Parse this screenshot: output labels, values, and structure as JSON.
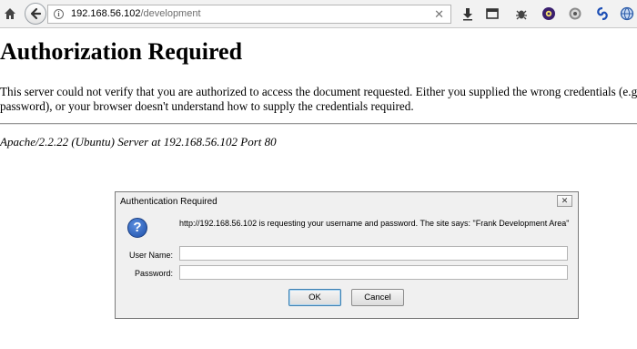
{
  "browser": {
    "url_host": "192.168.56.102",
    "url_path": "/development",
    "colors": {
      "toolbar_bg": "#f2f2f2"
    },
    "icons": [
      "home-icon",
      "back-arrow-icon",
      "page-info-icon",
      "clear-url-icon",
      "download-icon",
      "reader-view-icon",
      "addon-bug-icon",
      "addon-gear-icon",
      "addon-cog-icon",
      "addon-swirl-icon",
      "addon-globe-icon"
    ]
  },
  "page": {
    "title": "Authorization Required",
    "message": "This server could not verify that you are authorized to access the document requested. Either you supplied the wrong credentials (e.g., bad password), or your browser doesn't understand how to supply the credentials required.",
    "signature": "Apache/2.2.22 (Ubuntu) Server at 192.168.56.102 Port 80"
  },
  "dialog": {
    "title": "Authentication Required",
    "close_label": "✕",
    "message": "http://192.168.56.102 is requesting your username and password. The site says: \"Frank Development Area\"",
    "username_label": "User Name:",
    "username_value": "",
    "password_label": "Password:",
    "password_value": "",
    "ok_label": "OK",
    "cancel_label": "Cancel",
    "icon": "question-icon"
  }
}
